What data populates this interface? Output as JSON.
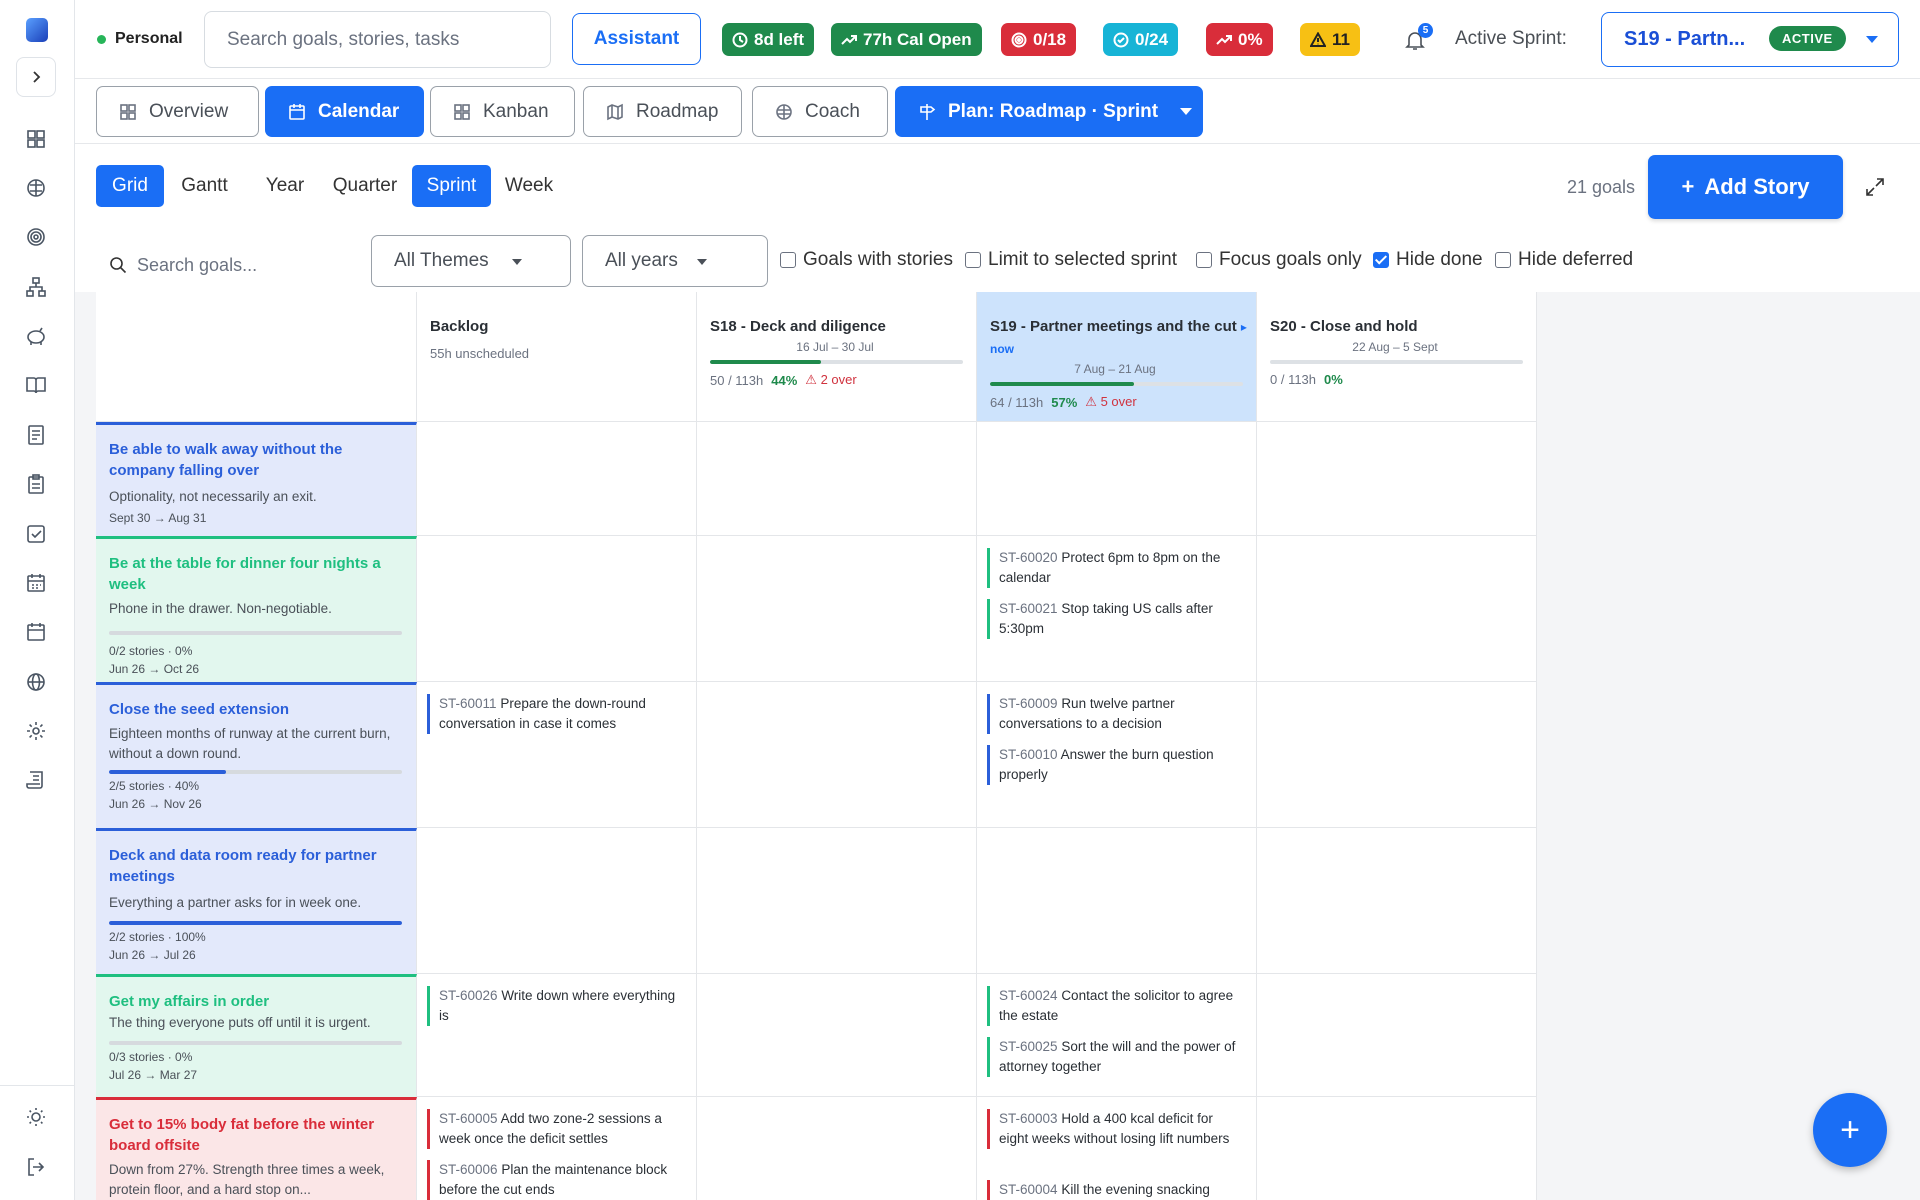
{
  "topbar": {
    "persona": "Personal",
    "search_placeholder": "Search goals, stories, tasks",
    "assistant": "Assistant",
    "pills": [
      {
        "label": "8d left",
        "icon": "clock-icon",
        "color": "#1f8a4c"
      },
      {
        "label": "77h Cal Open",
        "icon": "trend-up-icon",
        "color": "#1f8a4c"
      },
      {
        "label": "0/18",
        "icon": "target-icon",
        "color": "#d92d3a"
      },
      {
        "label": "0/24",
        "icon": "check-circle-icon",
        "color": "#17b4d6"
      },
      {
        "label": "0%",
        "icon": "trend-up-icon",
        "color": "#d92d3a"
      },
      {
        "label": "11",
        "icon": "warning-icon",
        "color": "#f7c014"
      }
    ],
    "notifications": "5",
    "active_sprint_label": "Active Sprint:",
    "active_sprint_name": "S19 - Partn...",
    "active_badge": "ACTIVE"
  },
  "tabs": {
    "overview": "Overview",
    "calendar": "Calendar",
    "kanban": "Kanban",
    "roadmap": "Roadmap",
    "coach": "Coach",
    "plan": "Plan: Roadmap · Sprint"
  },
  "views": {
    "grid": "Grid",
    "gantt": "Gantt",
    "year": "Year",
    "quarter": "Quarter",
    "sprint": "Sprint",
    "week": "Week",
    "goals_count": "21 goals",
    "add_story": "Add Story"
  },
  "filters": {
    "search_placeholder": "Search goals...",
    "themes": "All Themes",
    "years": "All years",
    "goals_with_stories": "Goals with stories",
    "limit_sprint": "Limit to selected sprint",
    "focus_only": "Focus goals only",
    "hide_done": "Hide done",
    "hide_deferred": "Hide deferred"
  },
  "columns": [
    {
      "title": "Backlog",
      "sub": "55h unscheduled"
    },
    {
      "title": "S18 - Deck and diligence",
      "dates": "16 Jul – 30 Jul",
      "hours": "50 / 113h",
      "pct": "44%",
      "over": "2 over",
      "progress": 0.44
    },
    {
      "title": "S19 - Partner meetings and the cut",
      "now": "▸ now",
      "dates": "7 Aug – 21 Aug",
      "hours": "64 / 113h",
      "pct": "57%",
      "over": "5 over",
      "progress": 0.57
    },
    {
      "title": "S20 - Close and hold",
      "dates": "22 Aug – 5 Sept",
      "hours": "0 / 113h",
      "pct": "0%",
      "progress": 0
    }
  ],
  "goals": [
    {
      "title": "Be able to walk away without the company falling over",
      "desc": "Optionality, not necessarily an exit.",
      "dates": "Sept 30 → Aug 31",
      "color": "#2b5fd9",
      "bg": "#e3e9fb"
    },
    {
      "title": "Be at the table for dinner four nights a week",
      "desc": "Phone in the drawer. Non-negotiable.",
      "stories": "0/2 stories · 0%",
      "dates": "Jun 26 → Oct 26",
      "color": "#1fbf80",
      "bg": "#e2f7ee",
      "progress": 0
    },
    {
      "title": "Close the seed extension",
      "desc": "Eighteen months of runway at the current burn, without a down round.",
      "stories": "2/5 stories · 40%",
      "dates": "Jun 26 → Nov 26",
      "color": "#2b5fd9",
      "bg": "#e3e9fb",
      "progress": 0.4
    },
    {
      "title": "Deck and data room ready for partner meetings",
      "desc": "Everything a partner asks for in week one.",
      "stories": "2/2 stories · 100%",
      "dates": "Jun 26 → Jul 26",
      "color": "#2b5fd9",
      "bg": "#e3e9fb",
      "progress": 1
    },
    {
      "title": "Get my affairs in order",
      "desc": "The thing everyone puts off until it is urgent.",
      "stories": "0/3 stories · 0%",
      "dates": "Jul 26 → Mar 27",
      "color": "#1fbf80",
      "bg": "#e2f7ee",
      "progress": 0
    },
    {
      "title": "Get to 15% body fat before the winter board offsite",
      "desc": "Down from 27%. Strength three times a week, protein floor, and a hard stop on...",
      "color": "#d92d3a",
      "bg": "#fbe6e7"
    }
  ],
  "stories": {
    "g2_s19": [
      {
        "id": "ST-60020",
        "text": "Protect 6pm to 8pm on the calendar"
      },
      {
        "id": "ST-60021",
        "text": "Stop taking US calls after 5:30pm"
      }
    ],
    "g3_backlog": [
      {
        "id": "ST-60011",
        "text": "Prepare the down-round conversation in case it comes"
      }
    ],
    "g3_s19": [
      {
        "id": "ST-60009",
        "text": "Run twelve partner conversations to a decision"
      },
      {
        "id": "ST-60010",
        "text": "Answer the burn question properly"
      }
    ],
    "g5_backlog": [
      {
        "id": "ST-60026",
        "text": "Write down where everything is"
      }
    ],
    "g5_s19": [
      {
        "id": "ST-60024",
        "text": "Contact the solicitor to agree the estate"
      },
      {
        "id": "ST-60025",
        "text": "Sort the will and the power of attorney together"
      }
    ],
    "g6_backlog": [
      {
        "id": "ST-60005",
        "text": "Add two zone-2 sessions a week once the deficit settles"
      },
      {
        "id": "ST-60006",
        "text": "Plan the maintenance block before the cut ends"
      }
    ],
    "g6_s19": [
      {
        "id": "ST-60003",
        "text": "Hold a 400 kcal deficit for eight weeks without losing lift numbers"
      },
      {
        "id": "ST-60004",
        "text": "Kill the evening snacking"
      }
    ]
  }
}
